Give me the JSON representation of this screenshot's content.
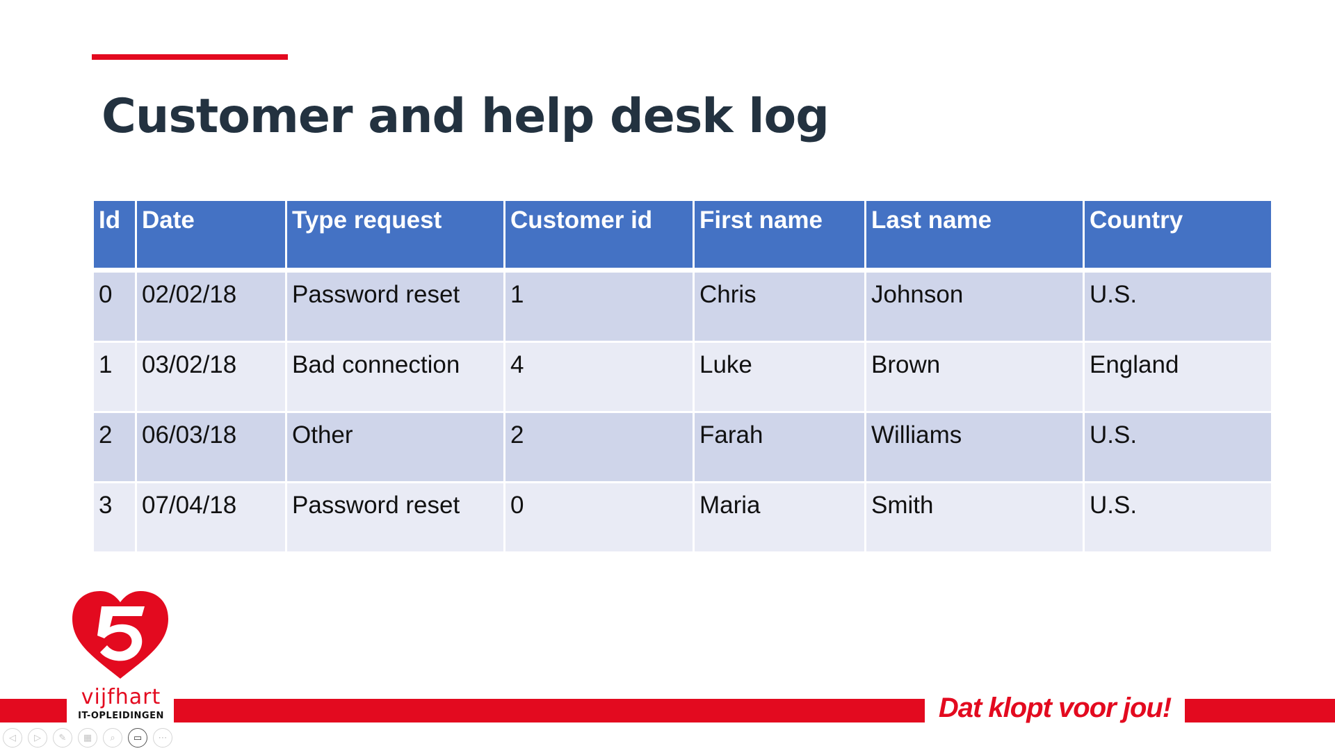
{
  "slide": {
    "title": "Customer and help desk log",
    "accent_color": "#e30a1f",
    "title_color": "#233240"
  },
  "table": {
    "header_color": "#4472c4",
    "row_color_odd": "#cfd5ea",
    "row_color_even": "#e9ebf5",
    "columns": [
      "Id",
      "Date",
      "Type request",
      "Customer id",
      "First name",
      "Last name",
      "Country"
    ],
    "rows": [
      [
        "0",
        "02/02/18",
        "Password reset",
        "1",
        "Chris",
        "Johnson",
        "U.S."
      ],
      [
        "1",
        "03/02/18",
        "Bad connection",
        "4",
        "Luke",
        "Brown",
        "England"
      ],
      [
        "2",
        "06/03/18",
        "Other",
        "2",
        "Farah",
        "Williams",
        "U.S."
      ],
      [
        "3",
        "07/04/18",
        "Password reset",
        "0",
        "Maria",
        "Smith",
        "U.S."
      ]
    ]
  },
  "brand": {
    "name": "vijfhart",
    "subtitle": "IT-OPLEIDINGEN",
    "tagline": "Dat klopt voor jou!",
    "color": "#e30a1f"
  },
  "toolbar": {
    "buttons": [
      {
        "icon": "previous-slide-icon",
        "glyph": "◁"
      },
      {
        "icon": "next-slide-icon",
        "glyph": "▷"
      },
      {
        "icon": "pen-icon",
        "glyph": "✎"
      },
      {
        "icon": "see-all-slides-icon",
        "glyph": "▦"
      },
      {
        "icon": "zoom-icon",
        "glyph": "⌕"
      },
      {
        "icon": "camera-icon",
        "glyph": "▭"
      },
      {
        "icon": "more-options-icon",
        "glyph": "⋯"
      }
    ]
  }
}
